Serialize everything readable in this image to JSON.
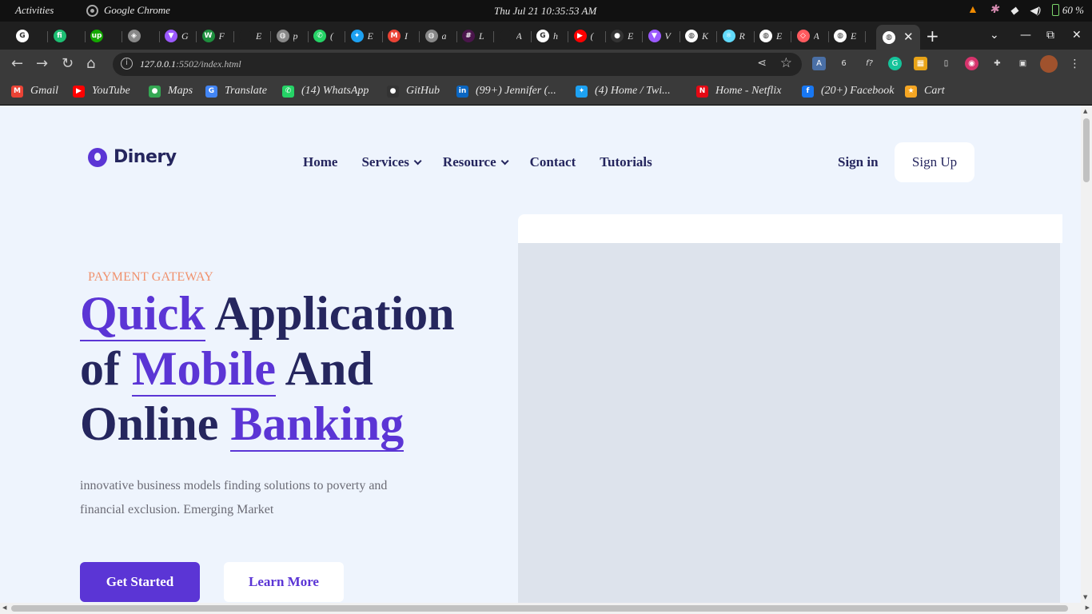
{
  "system": {
    "activities": "Activities",
    "app_name": "Google Chrome",
    "clock": "Thu Jul 21  10:35:53 AM",
    "battery": "60 %"
  },
  "tabs": [
    {
      "title": "",
      "icon": "google-icon",
      "color": "#ffffff"
    },
    {
      "title": "",
      "icon": "fiverr-icon",
      "color": "#1dbf73"
    },
    {
      "title": "",
      "icon": "upwork-icon",
      "color": "#14a800"
    },
    {
      "title": "",
      "icon": "app-icon",
      "color": "#888888"
    },
    {
      "title": "G",
      "icon": "vite-icon",
      "color": "#9b59ff"
    },
    {
      "title": "F",
      "icon": "webflow-icon",
      "color": "#1e8f3e"
    },
    {
      "title": "E",
      "icon": "blank-icon",
      "color": "#1f1f1f"
    },
    {
      "title": "p",
      "icon": "globe-icon",
      "color": "#888888"
    },
    {
      "title": "(",
      "icon": "whatsapp-icon",
      "color": "#25d366"
    },
    {
      "title": "E",
      "icon": "twitter-icon",
      "color": "#1da1f2"
    },
    {
      "title": "I",
      "icon": "gmail-icon",
      "color": "#ea4335"
    },
    {
      "title": "a",
      "icon": "globe-icon",
      "color": "#888888"
    },
    {
      "title": "L",
      "icon": "slack-icon",
      "color": "#4a154b"
    },
    {
      "title": "A",
      "icon": "blank-icon",
      "color": "#1f1f1f"
    },
    {
      "title": "h",
      "icon": "google-icon",
      "color": "#ffffff"
    },
    {
      "title": "(",
      "icon": "youtube-icon",
      "color": "#ff0000"
    },
    {
      "title": "E",
      "icon": "github-icon",
      "color": "#333333"
    },
    {
      "title": "V",
      "icon": "vite-icon",
      "color": "#9b59ff"
    },
    {
      "title": "K",
      "icon": "globe-icon",
      "color": "#ffffff"
    },
    {
      "title": "R",
      "icon": "react-icon",
      "color": "#61dafb"
    },
    {
      "title": "E",
      "icon": "globe-icon",
      "color": "#ffffff"
    },
    {
      "title": "A",
      "icon": "airbnb-icon",
      "color": "#ff5a5f"
    },
    {
      "title": "E",
      "icon": "globe-icon",
      "color": "#ffffff"
    }
  ],
  "active_tab": {
    "icon": "globe-icon",
    "close": "✕"
  },
  "browser": {
    "url_host": "127.0.0.1",
    "url_path": ":5502/index.html"
  },
  "bookmarks": [
    {
      "label": "Gmail",
      "icon": "gmail-icon",
      "color": "#ea4335",
      "glyph": "M"
    },
    {
      "label": "YouTube",
      "icon": "youtube-icon",
      "color": "#ff0000",
      "glyph": "▶"
    },
    {
      "label": "Maps",
      "icon": "maps-icon",
      "color": "#34a853",
      "glyph": "●"
    },
    {
      "label": "Translate",
      "icon": "translate-icon",
      "color": "#4285f4",
      "glyph": "G"
    },
    {
      "label": "(14) WhatsApp",
      "icon": "whatsapp-icon",
      "color": "#25d366",
      "glyph": "✆"
    },
    {
      "label": "GitHub",
      "icon": "github-icon",
      "color": "#333333",
      "glyph": "●"
    },
    {
      "label": "(99+) Jennifer (...",
      "icon": "linkedin-icon",
      "color": "#0a66c2",
      "glyph": "in"
    },
    {
      "label": "(4) Home / Twi...",
      "icon": "twitter-icon",
      "color": "#1da1f2",
      "glyph": "✦"
    },
    {
      "label": "Home - Netflix",
      "icon": "netflix-icon",
      "color": "#e50914",
      "glyph": "N"
    },
    {
      "label": "(20+) Facebook",
      "icon": "facebook-icon",
      "color": "#1877f2",
      "glyph": "f"
    },
    {
      "label": "Cart",
      "icon": "cart-icon",
      "color": "#f5a623",
      "glyph": "★"
    }
  ],
  "site": {
    "brand": "Dinery",
    "nav": [
      {
        "label": "Home",
        "dropdown": false
      },
      {
        "label": "Services",
        "dropdown": true
      },
      {
        "label": "Resource",
        "dropdown": true
      },
      {
        "label": "Contact",
        "dropdown": false
      },
      {
        "label": "Tutorials",
        "dropdown": false
      }
    ],
    "sign_in": "Sign in",
    "sign_up": "Sign Up",
    "eyebrow": "PAYMENT GATEWAY",
    "headline": {
      "w1": "Quick",
      "w2": "Application",
      "w3": "of",
      "w4": "Mobile",
      "w5": "And",
      "w6": "Online",
      "w7": "Banking"
    },
    "description": "innovative business models finding solutions to poverty and financial exclusion. Emerging Market",
    "primary_cta": "Get Started",
    "secondary_cta": "Learn More",
    "accent_color": "#5b35d5",
    "heading_color": "#25265e",
    "eyebrow_color": "#f0916d"
  }
}
